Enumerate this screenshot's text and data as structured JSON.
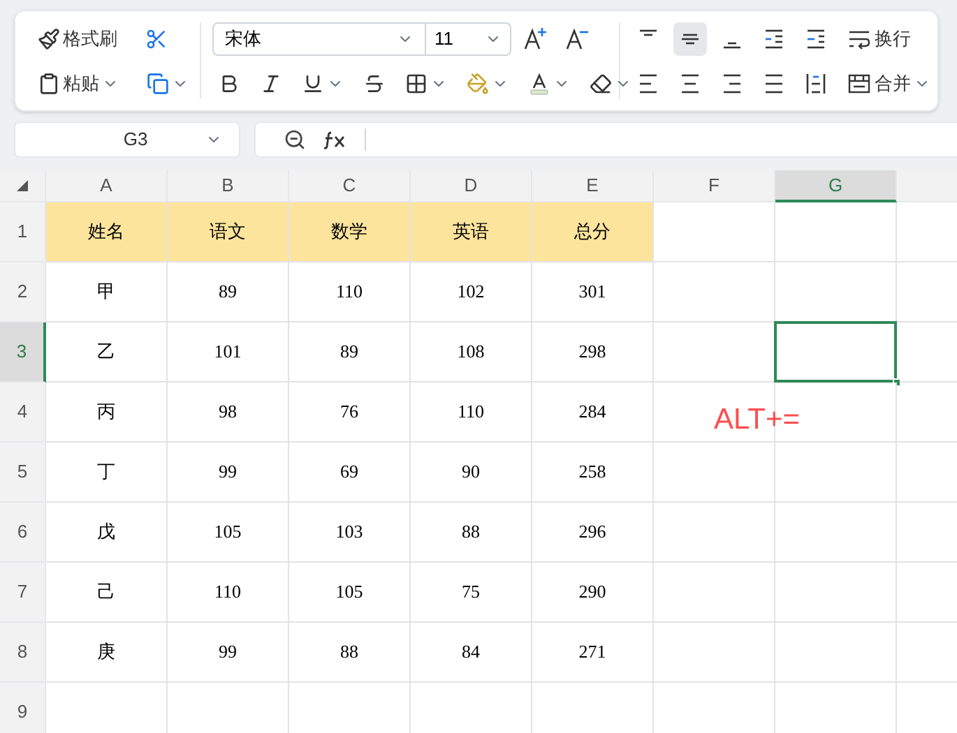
{
  "ribbon": {
    "clipboard": {
      "format_painter": "格式刷",
      "paste": "粘贴"
    },
    "font": {
      "family": "宋体",
      "size": "11"
    },
    "alignment": [
      {
        "kind": "top",
        "selected": false
      },
      {
        "kind": "middle",
        "selected": true
      },
      {
        "kind": "bottom",
        "selected": false
      },
      {
        "kind": "outdent",
        "selected": false
      },
      {
        "kind": "indent",
        "selected": false
      },
      {
        "kind": "left",
        "selected": false
      },
      {
        "kind": "center",
        "selected": false
      },
      {
        "kind": "right",
        "selected": false
      },
      {
        "kind": "justify",
        "selected": false
      },
      {
        "kind": "distributed",
        "selected": false
      }
    ],
    "wrap_text": "换行",
    "merge": "合并"
  },
  "name_box": "G3",
  "columns": [
    {
      "label": "A",
      "selected": false
    },
    {
      "label": "B",
      "selected": false
    },
    {
      "label": "C",
      "selected": false
    },
    {
      "label": "D",
      "selected": false
    },
    {
      "label": "E",
      "selected": false
    },
    {
      "label": "F",
      "selected": false
    },
    {
      "label": "G",
      "selected": true
    }
  ],
  "rows": [
    {
      "label": "1",
      "selected": false,
      "kind": "header",
      "cells": [
        "姓名",
        "语文",
        "数学",
        "英语",
        "总分"
      ]
    },
    {
      "label": "2",
      "selected": false,
      "kind": "data",
      "cells": [
        "甲",
        "89",
        "110",
        "102",
        "301"
      ]
    },
    {
      "label": "3",
      "selected": true,
      "kind": "data",
      "cells": [
        "乙",
        "101",
        "89",
        "108",
        "298"
      ]
    },
    {
      "label": "4",
      "selected": false,
      "kind": "data",
      "cells": [
        "丙",
        "98",
        "76",
        "110",
        "284"
      ]
    },
    {
      "label": "5",
      "selected": false,
      "kind": "data",
      "cells": [
        "丁",
        "99",
        "69",
        "90",
        "258"
      ]
    },
    {
      "label": "6",
      "selected": false,
      "kind": "data",
      "cells": [
        "戊",
        "105",
        "103",
        "88",
        "296"
      ]
    },
    {
      "label": "7",
      "selected": false,
      "kind": "data",
      "cells": [
        "己",
        "110",
        "105",
        "75",
        "290"
      ]
    },
    {
      "label": "8",
      "selected": false,
      "kind": "data",
      "cells": [
        "庚",
        "99",
        "88",
        "84",
        "271"
      ]
    },
    {
      "label": "9",
      "selected": false,
      "kind": "data"
    }
  ],
  "annotation": "ALT+="
}
